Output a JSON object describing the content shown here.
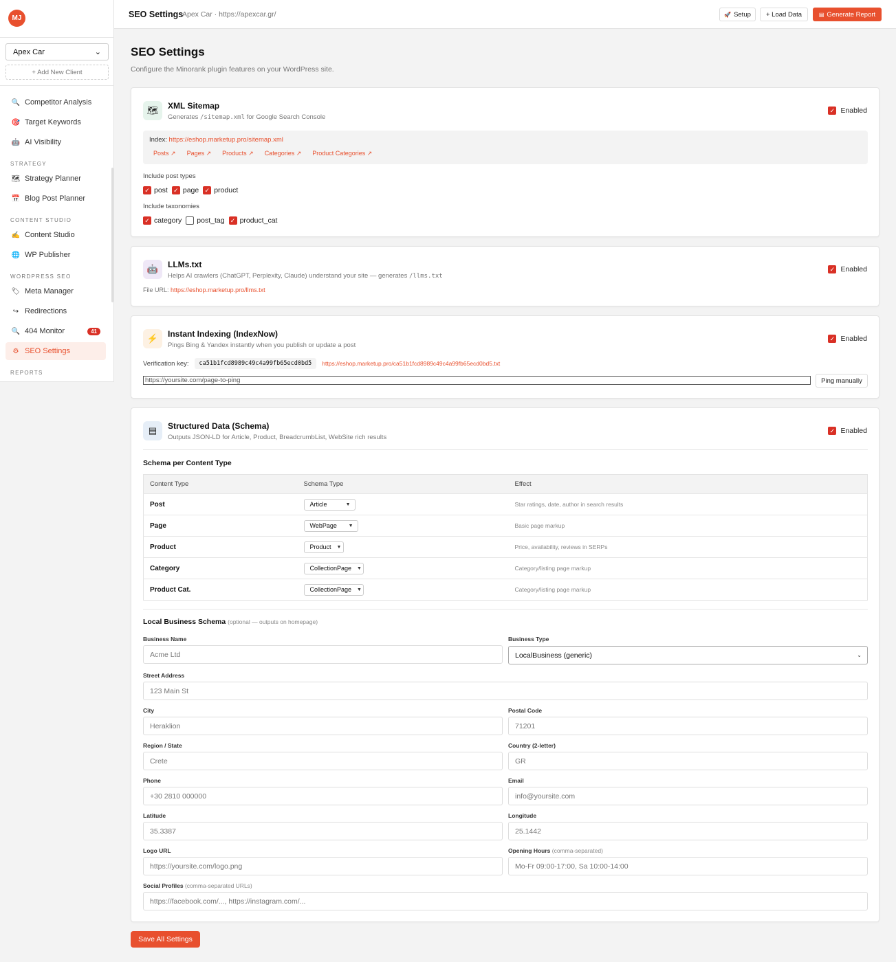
{
  "app": {
    "logo_text": "MJ"
  },
  "sidebar": {
    "client": "Apex Car",
    "add_client": "+ Add New Client",
    "items_top": [
      {
        "label": "Competitor Analysis",
        "icon": "magnifier-icon"
      },
      {
        "label": "Target Keywords",
        "icon": "target-icon"
      },
      {
        "label": "AI Visibility",
        "icon": "robot-icon"
      }
    ],
    "section_strategy": "STRATEGY",
    "items_strategy": [
      {
        "label": "Strategy Planner",
        "icon": "map-icon"
      },
      {
        "label": "Blog Post Planner",
        "icon": "calendar-icon"
      }
    ],
    "section_content": "CONTENT STUDIO",
    "items_content": [
      {
        "label": "Content Studio",
        "icon": "pen-icon"
      },
      {
        "label": "WP Publisher",
        "icon": "globe-icon"
      }
    ],
    "section_wpseo": "WORDPRESS SEO",
    "items_wpseo": [
      {
        "label": "Meta Manager",
        "icon": "tag-icon"
      },
      {
        "label": "Redirections",
        "icon": "redirect-icon"
      },
      {
        "label": "404 Monitor",
        "icon": "magnifier-icon",
        "badge": "41"
      },
      {
        "label": "SEO Settings",
        "icon": "gear-icon"
      }
    ],
    "section_reports": "REPORTS"
  },
  "topbar": {
    "title": "SEO Settings",
    "subtitle": "Apex Car · https://apexcar.gr/",
    "setup": "Setup",
    "load_data": "+ Load Data",
    "generate_report": "Generate Report"
  },
  "page": {
    "title": "SEO Settings",
    "subtitle": "Configure the Minorank plugin features on your WordPress site."
  },
  "sitemap": {
    "title": "XML Sitemap",
    "desc_pre": "Generates ",
    "desc_code": "/sitemap.xml",
    "desc_post": " for Google Search Console",
    "enabled": "Enabled",
    "index_label": "Index:",
    "index_url": "https://eshop.marketup.pro/sitemap.xml",
    "links": [
      "Posts ↗",
      "Pages ↗",
      "Products ↗",
      "Categories ↗",
      "Product Categories ↗"
    ],
    "post_types_label": "Include post types",
    "post_types": [
      {
        "label": "post",
        "checked": true
      },
      {
        "label": "page",
        "checked": true
      },
      {
        "label": "product",
        "checked": true
      }
    ],
    "taxonomies_label": "Include taxonomies",
    "taxonomies": [
      {
        "label": "category",
        "checked": true
      },
      {
        "label": "post_tag",
        "checked": false
      },
      {
        "label": "product_cat",
        "checked": true
      }
    ]
  },
  "llms": {
    "title": "LLMs.txt",
    "desc_pre": "Helps AI crawlers (ChatGPT, Perplexity, Claude) understand your site — generates ",
    "desc_code": "/llms.txt",
    "enabled": "Enabled",
    "file_label": "File URL:",
    "file_url": "https://eshop.marketup.pro/llms.txt"
  },
  "indexnow": {
    "title": "Instant Indexing (IndexNow)",
    "desc": "Pings Bing & Yandex instantly when you publish or update a post",
    "enabled": "Enabled",
    "key_label": "Verification key:",
    "key": "ca51b1fcd8989c49c4a99fb65ecd0bd5",
    "key_url": "https://eshop.marketup.pro/ca51b1fcd8989c49c4a99fb65ecd0bd5.txt",
    "ping_placeholder": "https://yoursite.com/page-to-ping",
    "ping_button": "Ping manually"
  },
  "schema": {
    "title": "Structured Data (Schema)",
    "desc": "Outputs JSON-LD for Article, Product, BreadcrumbList, WebSite rich results",
    "enabled": "Enabled",
    "per_type_title": "Schema per Content Type",
    "columns": [
      "Content Type",
      "Schema Type",
      "Effect"
    ],
    "rows": [
      {
        "type": "Post",
        "schema": "Article",
        "effect": "Star ratings, date, author in search results"
      },
      {
        "type": "Page",
        "schema": "WebPage",
        "effect": "Basic page markup"
      },
      {
        "type": "Product",
        "schema": "Product",
        "effect": "Price, availability, reviews in SERPs"
      },
      {
        "type": "Category",
        "schema": "CollectionPage",
        "effect": "Category/listing page markup"
      },
      {
        "type": "Product Cat.",
        "schema": "CollectionPage",
        "effect": "Category/listing page markup"
      }
    ],
    "local_title": "Local Business Schema",
    "local_note": "(optional — outputs on homepage)",
    "fields": {
      "business_name": {
        "label": "Business Name",
        "placeholder": "Acme Ltd"
      },
      "business_type": {
        "label": "Business Type",
        "value": "LocalBusiness (generic)"
      },
      "street": {
        "label": "Street Address",
        "placeholder": "123 Main St"
      },
      "city": {
        "label": "City",
        "placeholder": "Heraklion"
      },
      "postal": {
        "label": "Postal Code",
        "placeholder": "71201"
      },
      "region": {
        "label": "Region / State",
        "placeholder": "Crete"
      },
      "country": {
        "label": "Country (2-letter)",
        "placeholder": "GR"
      },
      "phone": {
        "label": "Phone",
        "placeholder": "+30 2810 000000"
      },
      "email": {
        "label": "Email",
        "placeholder": "info@yoursite.com"
      },
      "latitude": {
        "label": "Latitude",
        "placeholder": "35.3387"
      },
      "longitude": {
        "label": "Longitude",
        "placeholder": "25.1442"
      },
      "logo": {
        "label": "Logo URL",
        "placeholder": "https://yoursite.com/logo.png"
      },
      "hours": {
        "label": "Opening Hours",
        "note": "(comma-separated)",
        "placeholder": "Mo-Fr 09:00-17:00, Sa 10:00-14:00"
      },
      "social": {
        "label": "Social Profiles",
        "note": "(comma-separated URLs)",
        "placeholder": "https://facebook.com/..., https://instagram.com/..."
      }
    }
  },
  "save_button": "Save All Settings",
  "colors": {
    "accent": "#e8502e",
    "check": "#d93025"
  }
}
